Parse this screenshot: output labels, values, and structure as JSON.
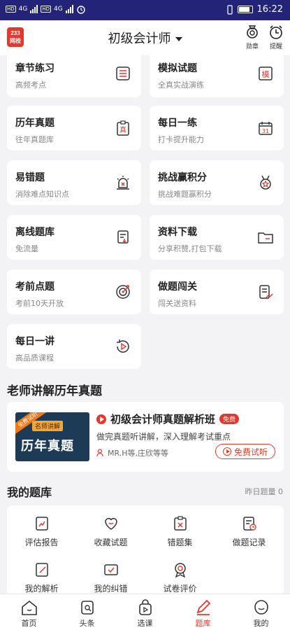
{
  "status": {
    "time": "16:22",
    "net1": "4G",
    "net2": "4G"
  },
  "header": {
    "logo_top": "233",
    "logo_bottom": "网校",
    "title": "初级会计师",
    "medal": "勋章",
    "remind": "提醒"
  },
  "cards": [
    {
      "title": "章节练习",
      "sub": "高频考点",
      "icon": "list-icon"
    },
    {
      "title": "模拟试题",
      "sub": "全真实战演练",
      "icon": "mock-exam-icon"
    },
    {
      "title": "历年真题",
      "sub": "往年真题库",
      "icon": "past-papers-icon"
    },
    {
      "title": "每日一练",
      "sub": "打卡提升能力",
      "icon": "calendar-icon"
    },
    {
      "title": "易错题",
      "sub": "消除难点知识点",
      "icon": "alarm-icon"
    },
    {
      "title": "挑战赢积分",
      "sub": "挑战难题赢积分",
      "icon": "medal-icon"
    },
    {
      "title": "离线题库",
      "sub": "免流量",
      "icon": "offline-icon"
    },
    {
      "title": "资料下载",
      "sub": "分享积赞,打包下载",
      "icon": "folder-icon"
    },
    {
      "title": "考前点题",
      "sub": "考前10天开放",
      "icon": "target-icon"
    },
    {
      "title": "做题闯关",
      "sub": "闯关送资料",
      "icon": "doc-chart-icon"
    },
    {
      "title": "每日一讲",
      "sub": "高品质课程",
      "icon": "replay-icon"
    }
  ],
  "icon_chars": {
    "mock": "模",
    "past": "真",
    "calendar": "31"
  },
  "teacher_section": {
    "title": "老师讲解历年真题"
  },
  "lecture": {
    "thumb_badge": "免费试听",
    "thumb_tag": "名师讲解",
    "thumb_text": "历年真题",
    "title": "初级会计师真题解析班",
    "free": "免费",
    "desc": "做完真题听讲解，深入理解考试重点",
    "teachers": "MR.H等,庄欣等等",
    "button": "免费试听"
  },
  "mybank": {
    "title": "我的题库",
    "yesterday": "昨日题量 0",
    "items": [
      "评估报告",
      "收藏试题",
      "错题集",
      "做题记录",
      "我的解析",
      "我的纠错",
      "试卷评价"
    ]
  },
  "nav": [
    "首页",
    "头条",
    "选课",
    "题库",
    "我的"
  ],
  "colors": {
    "accent": "#e03a2f",
    "status_bar": "#23237a"
  }
}
